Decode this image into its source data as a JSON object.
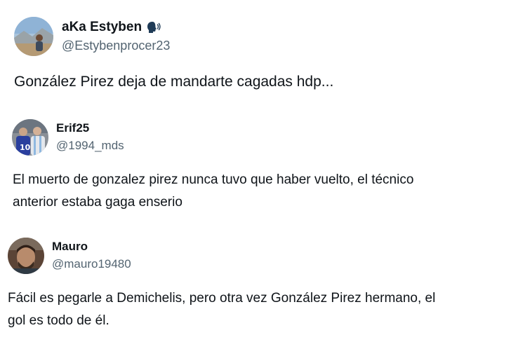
{
  "tweets": [
    {
      "display_name": "aKa Estyben",
      "handle": "@Estybenprocer23",
      "text_lines": [
        "González Pirez deja de mandarte cagadas hdp..."
      ],
      "badge_icon": "speaking-head-icon"
    },
    {
      "display_name": "Erif25",
      "handle": "@1994_mds",
      "text_lines": [
        "El muerto de gonzalez pirez nunca tuvo que haber vuelto, el técnico",
        "anterior estaba gaga enserio"
      ]
    },
    {
      "display_name": "Mauro",
      "handle": "@mauro19480",
      "text_lines": [
        "Fácil es pegarle a Demichelis, pero otra vez González Pirez hermano, el",
        "gol es todo de él."
      ]
    }
  ],
  "colors": {
    "text_primary": "#0f1419",
    "text_secondary": "#536471",
    "background": "#ffffff"
  }
}
